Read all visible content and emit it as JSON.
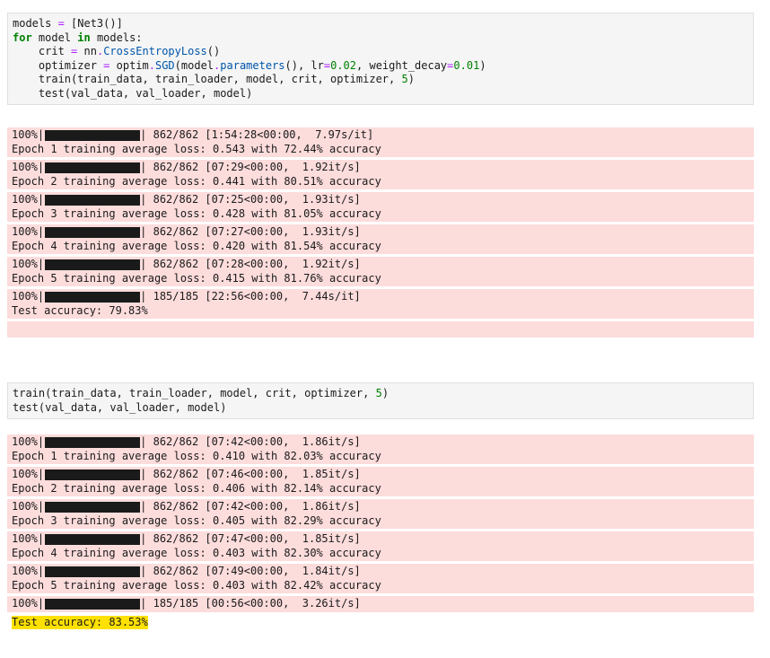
{
  "cell1": {
    "code": [
      [
        {
          "t": "models ",
          "c": ""
        },
        {
          "t": "=",
          "c": "op"
        },
        {
          "t": " [Net3()]",
          "c": ""
        }
      ],
      [
        {
          "t": "for",
          "c": "kw"
        },
        {
          "t": " model ",
          "c": ""
        },
        {
          "t": "in",
          "c": "kw"
        },
        {
          "t": " models:",
          "c": ""
        }
      ],
      [
        {
          "t": "    crit ",
          "c": ""
        },
        {
          "t": "=",
          "c": "op"
        },
        {
          "t": " nn",
          "c": ""
        },
        {
          "t": ".",
          "c": "op"
        },
        {
          "t": "CrossEntropyLoss",
          "c": "cls"
        },
        {
          "t": "()",
          "c": ""
        }
      ],
      [
        {
          "t": "    optimizer ",
          "c": ""
        },
        {
          "t": "=",
          "c": "op"
        },
        {
          "t": " optim",
          "c": ""
        },
        {
          "t": ".",
          "c": "op"
        },
        {
          "t": "SGD",
          "c": "cls"
        },
        {
          "t": "(model",
          "c": ""
        },
        {
          "t": ".",
          "c": "op"
        },
        {
          "t": "parameters",
          "c": "cls"
        },
        {
          "t": "(), lr",
          "c": ""
        },
        {
          "t": "=",
          "c": "op"
        },
        {
          "t": "0.02",
          "c": "num"
        },
        {
          "t": ", weight_decay",
          "c": ""
        },
        {
          "t": "=",
          "c": "op"
        },
        {
          "t": "0.01",
          "c": "num"
        },
        {
          "t": ")",
          "c": ""
        }
      ],
      [
        {
          "t": "    train(train_data, train_loader, model, crit, optimizer, ",
          "c": ""
        },
        {
          "t": "5",
          "c": "num"
        },
        {
          "t": ")",
          "c": ""
        }
      ],
      [
        {
          "t": "    test(val_data, val_loader, model)",
          "c": ""
        }
      ]
    ],
    "output": [
      {
        "pct": "100%",
        "progress": 1.0,
        "stats": "862/862 [1:54:28<00:00,  7.97s/it]",
        "msg": "Epoch 1 training average loss: 0.543 with 72.44% accuracy"
      },
      {
        "pct": "100%",
        "progress": 1.0,
        "stats": "862/862 [07:29<00:00,  1.92it/s]",
        "msg": "Epoch 2 training average loss: 0.441 with 80.51% accuracy"
      },
      {
        "pct": "100%",
        "progress": 1.0,
        "stats": "862/862 [07:25<00:00,  1.93it/s]",
        "msg": "Epoch 3 training average loss: 0.428 with 81.05% accuracy"
      },
      {
        "pct": "100%",
        "progress": 1.0,
        "stats": "862/862 [07:27<00:00,  1.93it/s]",
        "msg": "Epoch 4 training average loss: 0.420 with 81.54% accuracy"
      },
      {
        "pct": "100%",
        "progress": 1.0,
        "stats": "862/862 [07:28<00:00,  1.92it/s]",
        "msg": "Epoch 5 training average loss: 0.415 with 81.76% accuracy"
      },
      {
        "pct": "100%",
        "progress": 1.0,
        "stats": "185/185 [22:56<00:00,  7.44s/it]",
        "msg": "Test accuracy: 79.83%"
      }
    ]
  },
  "cell2": {
    "code": [
      [
        {
          "t": "train(train_data, train_loader, model, crit, optimizer, ",
          "c": ""
        },
        {
          "t": "5",
          "c": "num"
        },
        {
          "t": ")",
          "c": ""
        }
      ],
      [
        {
          "t": "test(val_data, val_loader, model)",
          "c": ""
        }
      ]
    ],
    "output": [
      {
        "pct": "100%",
        "progress": 1.0,
        "stats": "862/862 [07:42<00:00,  1.86it/s]",
        "msg": "Epoch 1 training average loss: 0.410 with 82.03% accuracy"
      },
      {
        "pct": "100%",
        "progress": 1.0,
        "stats": "862/862 [07:46<00:00,  1.85it/s]",
        "msg": "Epoch 2 training average loss: 0.406 with 82.14% accuracy"
      },
      {
        "pct": "100%",
        "progress": 1.0,
        "stats": "862/862 [07:42<00:00,  1.86it/s]",
        "msg": "Epoch 3 training average loss: 0.405 with 82.29% accuracy"
      },
      {
        "pct": "100%",
        "progress": 1.0,
        "stats": "862/862 [07:47<00:00,  1.85it/s]",
        "msg": "Epoch 4 training average loss: 0.403 with 82.30% accuracy"
      },
      {
        "pct": "100%",
        "progress": 1.0,
        "stats": "862/862 [07:49<00:00,  1.84it/s]",
        "msg": "Epoch 5 training average loss: 0.403 with 82.42% accuracy"
      },
      {
        "pct": "100%",
        "progress": 1.0,
        "stats": "185/185 [00:56<00:00,  3.26it/s]",
        "msg": "Test accuracy: 83.53%",
        "highlight": true
      }
    ]
  }
}
